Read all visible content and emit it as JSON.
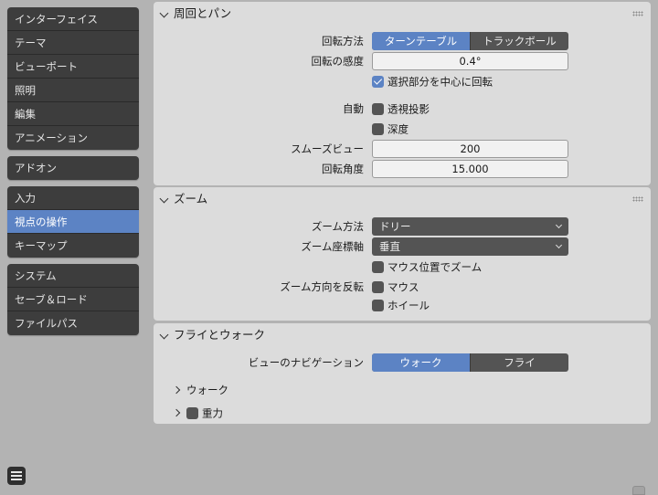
{
  "sidebar": {
    "groups": [
      [
        "インターフェイス",
        "テーマ",
        "ビューポート",
        "照明",
        "編集",
        "アニメーション"
      ],
      [
        "アドオン"
      ],
      [
        "入力",
        "視点の操作",
        "キーマップ"
      ],
      [
        "システム",
        "セーブ＆ロード",
        "ファイルパス"
      ]
    ],
    "active": "視点の操作"
  },
  "orbit_pan": {
    "title": "周回とパン",
    "rotation_method_label": "回転方法",
    "rotation_method_options": [
      "ターンテーブル",
      "トラックボール"
    ],
    "rotation_method_selected": "ターンテーブル",
    "orbit_sensitivity_label": "回転の感度",
    "orbit_sensitivity_value": "0.4°",
    "orbit_around_selection_label": "選択部分を中心に回転",
    "orbit_around_selection_checked": true,
    "auto_label": "自動",
    "auto_perspective_label": "透視投影",
    "auto_perspective_checked": false,
    "auto_depth_label": "深度",
    "auto_depth_checked": false,
    "smooth_view_label": "スムーズビュー",
    "smooth_view_value": "200",
    "rotation_angle_label": "回転角度",
    "rotation_angle_value": "15.000"
  },
  "zoom": {
    "title": "ズーム",
    "zoom_method_label": "ズーム方法",
    "zoom_method_value": "ドリー",
    "zoom_axis_label": "ズーム座標軸",
    "zoom_axis_value": "垂直",
    "zoom_to_mouse_label": "マウス位置でズーム",
    "zoom_to_mouse_checked": false,
    "invert_zoom_label": "ズーム方向を反転",
    "invert_mouse_label": "マウス",
    "invert_mouse_checked": false,
    "invert_wheel_label": "ホイール",
    "invert_wheel_checked": false
  },
  "fly_walk": {
    "title": "フライとウォーク",
    "view_navigation_label": "ビューのナビゲーション",
    "view_navigation_options": [
      "ウォーク",
      "フライ"
    ],
    "view_navigation_selected": "ウォーク",
    "walk_subpanel_label": "ウォーク",
    "gravity_subpanel_label": "重力",
    "gravity_checked": false
  },
  "colors": {
    "accent": "#5c83c4",
    "background": "#b3b3b3",
    "panel": "#dcdcdc",
    "sidebar": "#3d3d3d"
  }
}
